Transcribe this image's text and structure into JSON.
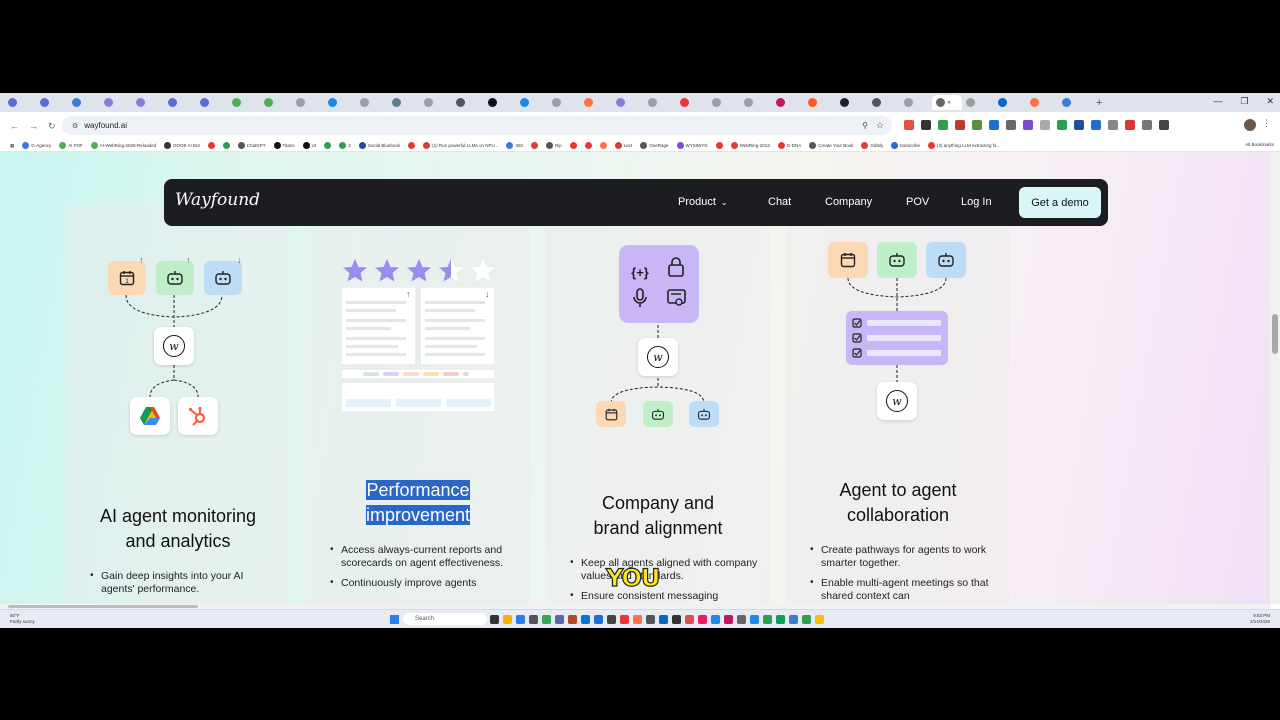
{
  "browser": {
    "url": "wayfound.ai",
    "tab_count": 38,
    "bookmarks": [
      "G-Agency",
      "AI FOF",
      "AI-WebRing-2025-Reloaded",
      "DOGE AI Bot",
      "",
      "",
      "ChatGPT",
      "Titans",
      "v3",
      "",
      "2",
      "Social Bluebook",
      "",
      "(1) Run powerful LLMs on NPU...",
      "360",
      "",
      "Rip",
      "",
      "",
      "",
      "Lect",
      "OneRage",
      "WYSIWYG",
      "",
      "WebRing-2013",
      "G-DNA",
      "Create Your Book",
      "Gibbly",
      "transcribe",
      "(3) anything LLM extracting fs..."
    ],
    "all_bookmarks": "All Bookmarks",
    "colors": {
      "accent": "#5b6bd6"
    }
  },
  "site": {
    "logo": "Wayfound",
    "nav": {
      "product": "Product",
      "chat": "Chat",
      "company": "Company",
      "pov": "POV",
      "login": "Log In",
      "demo": "Get a demo"
    },
    "cards": [
      {
        "title_line1": "AI agent monitoring",
        "title_line2": "and analytics",
        "bullets": [
          "Gain deep insights into your AI agents' performance."
        ]
      },
      {
        "title_line1": "Performance",
        "title_line2": "improvement",
        "bullets": [
          "Access always-current reports and scorecards on agent effectiveness.",
          "Continuously improve agents"
        ],
        "star_rating": 3.5
      },
      {
        "title_line1": "Company and",
        "title_line2": "brand alignment",
        "bullets": [
          "Keep all agents aligned with company values and standards.",
          "Ensure consistent messaging"
        ]
      },
      {
        "title_line1": "Agent to agent",
        "title_line2": "collaboration",
        "bullets": [
          "Create pathways for agents to work smarter together.",
          "Enable multi-agent meetings so that shared context can"
        ]
      }
    ],
    "w_mark": "w"
  },
  "overlay": {
    "caption": "YOU"
  },
  "taskbar": {
    "weather_temp": "50°F",
    "weather_desc": "Partly sunny",
    "search": "Search",
    "time": "9:53 PM",
    "date": "2/14/2025"
  },
  "icons": {
    "calendar": "calendar-icon",
    "robot": "robot-icon",
    "drive": "google-drive-icon",
    "hubspot": "hubspot-icon",
    "code": "code-braces-icon",
    "lock": "lock-icon",
    "mic": "microphone-icon",
    "certificate": "certificate-icon",
    "checklist": "checklist-icon"
  }
}
